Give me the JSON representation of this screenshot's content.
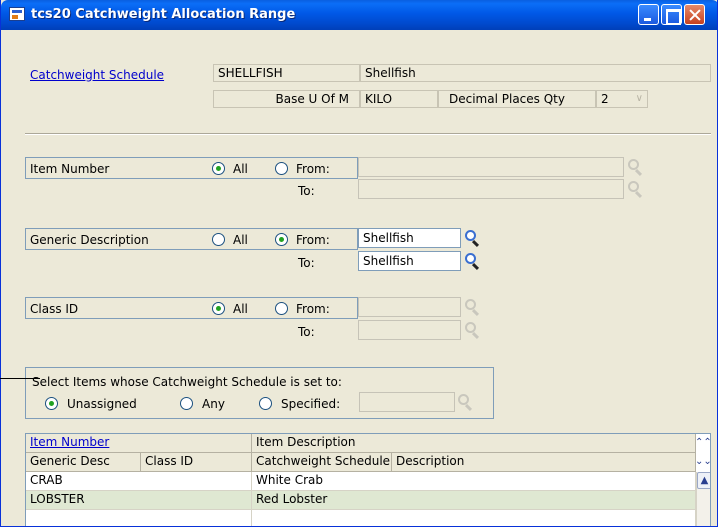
{
  "window": {
    "title": "tcs20 Catchweight Allocation Range"
  },
  "schedule": {
    "link_label": "Catchweight Schedule",
    "code": "SHELLFISH",
    "description": "Shellfish",
    "base_uom_label": "Base U Of M",
    "base_uom": "KILO",
    "decimal_places_label": "Decimal Places Qty",
    "decimal_places": "2"
  },
  "item_number": {
    "label": "Item Number",
    "all_label": "All",
    "from_label": "From:",
    "to_label": "To:",
    "selected": "All",
    "from_value": "",
    "to_value": ""
  },
  "generic_description": {
    "label": "Generic Description",
    "all_label": "All",
    "from_label": "From:",
    "to_label": "To:",
    "selected": "From",
    "from_value": "Shellfish",
    "to_value": "Shellfish"
  },
  "class_id": {
    "label": "Class  ID",
    "all_label": "All",
    "from_label": "From:",
    "to_label": "To:",
    "selected": "All",
    "from_value": "",
    "to_value": ""
  },
  "schedule_filter": {
    "label": "Select Items whose Catchweight  Schedule is set to:",
    "unassigned_label": "Unassigned",
    "any_label": "Any",
    "specified_label": "Specified:",
    "selected": "Unassigned",
    "specified_value": ""
  },
  "grid": {
    "headers_row1": [
      "Item Number",
      "Item Description"
    ],
    "headers_row2": [
      "Generic Desc",
      "Class ID",
      "Catchweight Schedule",
      "Description"
    ],
    "rows": [
      {
        "generic_desc": "CRAB",
        "item_description": "White Crab"
      },
      {
        "generic_desc": "LOBSTER",
        "item_description": "Red Lobster"
      }
    ]
  },
  "icons": {
    "lookup": "magnifier-icon",
    "collapse": "double-chevron-up-icon",
    "expand": "double-chevron-down-icon",
    "scroll_up": "scroll-up-arrow-icon"
  }
}
